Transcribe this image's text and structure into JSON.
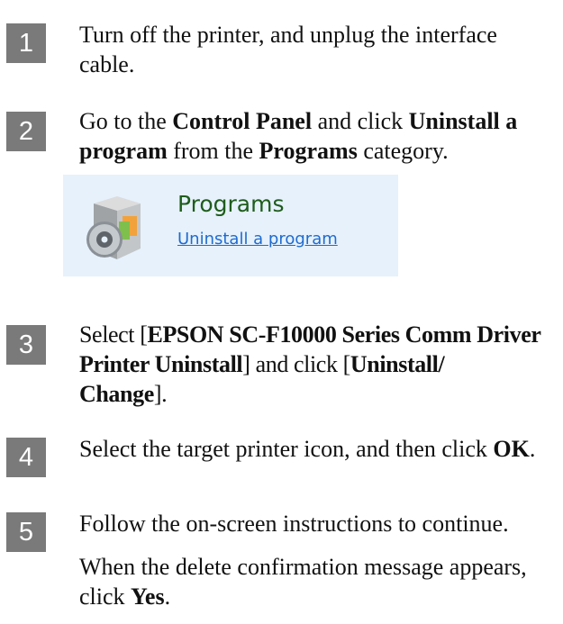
{
  "steps": [
    {
      "number": "1",
      "lines": [
        [
          {
            "t": "Turn off the printer, and unplug the interface",
            "b": false
          }
        ],
        [
          {
            "t": "cable.",
            "b": false
          }
        ]
      ]
    },
    {
      "number": "2",
      "lines": [
        [
          {
            "t": "Go to the ",
            "b": false
          },
          {
            "t": "Control Panel",
            "b": true
          },
          {
            "t": " and click ",
            "b": false
          },
          {
            "t": "Uninstall a",
            "b": true
          }
        ],
        [
          {
            "t": "program",
            "b": true
          },
          {
            "t": " from the ",
            "b": false
          },
          {
            "t": "Programs",
            "b": true
          },
          {
            "t": " category.",
            "b": false
          }
        ]
      ]
    },
    {
      "number": "3",
      "lines": [
        [
          {
            "t": "Select [",
            "b": false
          },
          {
            "t": "EPSON SC-F10000 Series Comm Driver",
            "b": true
          }
        ],
        [
          {
            "t": "Printer Uninstall",
            "b": true
          },
          {
            "t": "] and click [",
            "b": false
          },
          {
            "t": "Uninstall/",
            "b": true
          }
        ],
        [
          {
            "t": "Change",
            "b": true
          },
          {
            "t": "].",
            "b": false
          }
        ]
      ]
    },
    {
      "number": "4",
      "lines": [
        [
          {
            "t": "Select the target printer icon, and then click ",
            "b": false
          },
          {
            "t": "OK",
            "b": true
          },
          {
            "t": ".",
            "b": false
          }
        ]
      ]
    },
    {
      "number": "5",
      "lines": [
        [
          {
            "t": "Follow the on-screen instructions to continue.",
            "b": false
          }
        ]
      ],
      "extra_lines": [
        [
          {
            "t": "When the delete confirmation message appears,",
            "b": false
          }
        ],
        [
          {
            "t": "click ",
            "b": false
          },
          {
            "t": "Yes",
            "b": true
          },
          {
            "t": ".",
            "b": false
          }
        ]
      ]
    }
  ],
  "control_panel": {
    "icon": "programs-icon",
    "title": "Programs",
    "link": "Uninstall a program",
    "bg_color": "#e6f1fc",
    "title_color": "#1e5c1b",
    "link_color": "#1f6bcf"
  }
}
